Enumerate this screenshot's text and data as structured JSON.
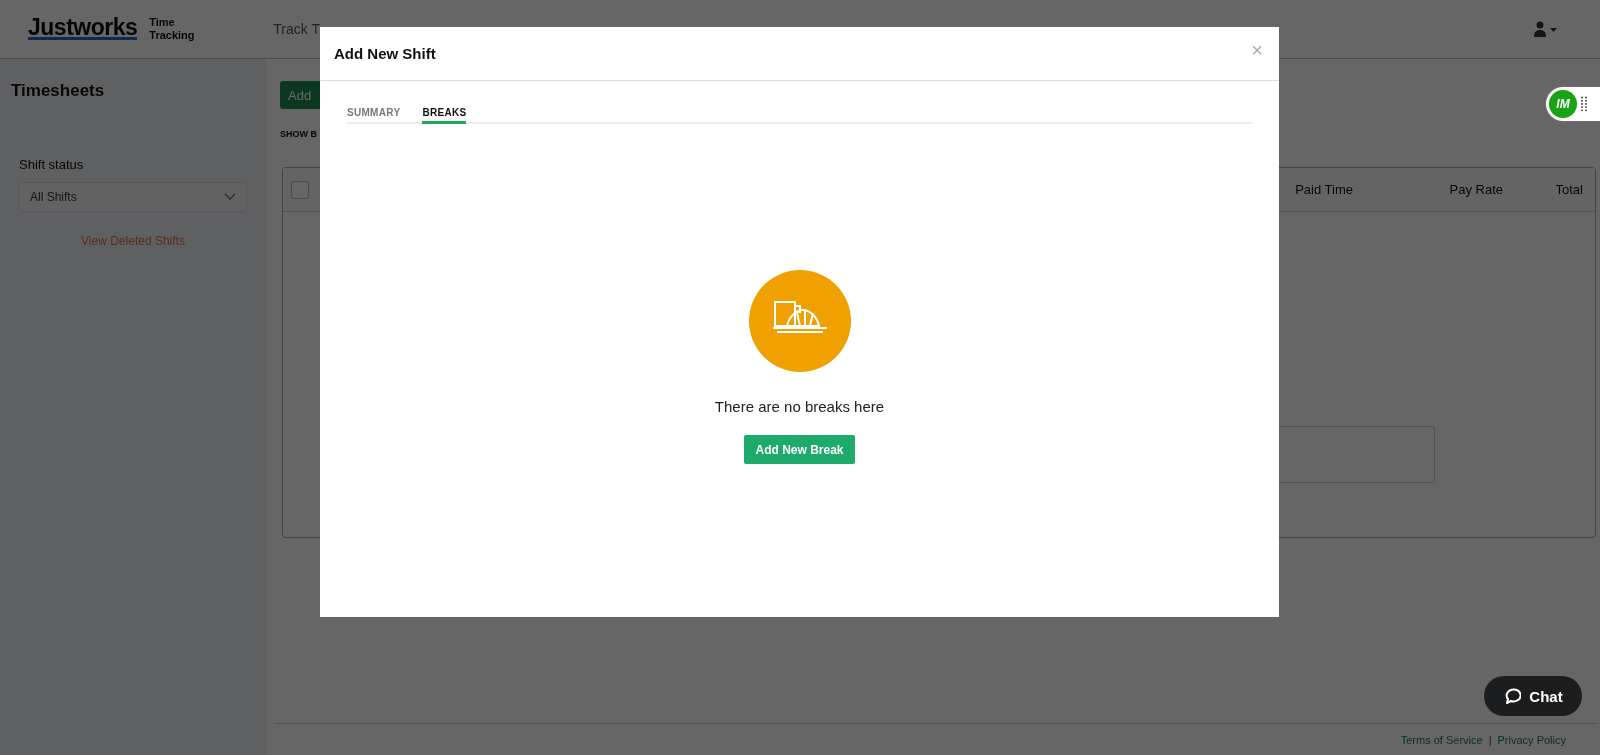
{
  "header": {
    "logo": "Justworks",
    "product": "Time Tracking",
    "nav": [
      "Track T"
    ]
  },
  "sidebar": {
    "title": "Timesheets",
    "filter_label": "Shift status",
    "filter_value": "All Shifts",
    "link": "View Deleted Shifts"
  },
  "main": {
    "add_button": "Add",
    "toggle_label": "SHOW B",
    "table": {
      "select_all_checked": false,
      "columns": [
        "Paid Time",
        "Pay Rate",
        "Total"
      ]
    }
  },
  "footer": {
    "links": [
      "Terms of Service",
      "Privacy Policy"
    ],
    "separator": "|"
  },
  "modal": {
    "title": "Add New Shift",
    "close": "×",
    "tabs": [
      {
        "label": "SUMMARY",
        "selected": false
      },
      {
        "label": "BREAKS",
        "selected": true
      }
    ],
    "empty_message": "There are no breaks here",
    "button": "Add New Break"
  },
  "widget": {
    "label": "IM"
  },
  "chat": {
    "label": "Chat"
  }
}
